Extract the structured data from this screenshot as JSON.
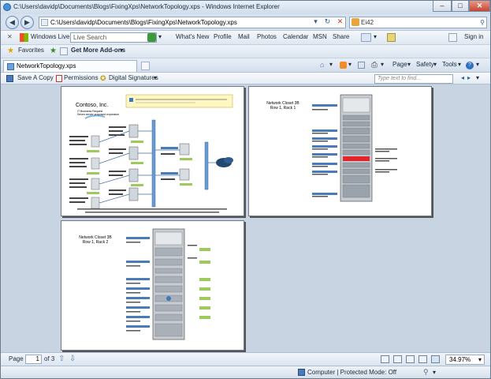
{
  "window": {
    "title": "C:\\Users\\davidp\\Documents\\Blogs\\FixingXps\\NetworkTopology.xps - Windows Internet Explorer",
    "minimize": "–",
    "maximize": "□",
    "close": "✕"
  },
  "address": {
    "url": "C:\\Users\\davidp\\Documents\\Blogs\\FixingXps\\NetworkTopology.xps",
    "search_value": "Ei42"
  },
  "toolbar": {
    "windows_live": "Windows Live",
    "live_search_placeholder": "Live Search",
    "links": [
      "What's New",
      "Profile",
      "Mail",
      "Photos",
      "Calendar",
      "MSN",
      "Share"
    ],
    "sign_in": "Sign in"
  },
  "favorites": {
    "favorites_label": "Favorites",
    "addons_label": "Get More Add-ons"
  },
  "tab": {
    "label": "NetworkTopology.xps"
  },
  "command_bar": {
    "page": "Page",
    "safety": "Safety",
    "tools": "Tools"
  },
  "xps_toolbar": {
    "save_copy": "Save A Copy",
    "permissions": "Permissions",
    "digital_signatures": "Digital Signatures",
    "find_placeholder": "Type text to find..."
  },
  "pages": {
    "page1": {
      "company": "Contoso, Inc.",
      "subtitle": "IT Business Request\nSeven server proposed expansion"
    },
    "page2": {
      "heading1": "Network Closet 3B",
      "heading2": "Row 1, Rack 1"
    },
    "page3": {
      "heading1": "Network Closet 3B",
      "heading2": "Row 1, Rack 2"
    }
  },
  "statusbar": {
    "page_label": "Page",
    "page_value": "1",
    "of_label": "of 3",
    "zoom": "34.97%",
    "zone": "Computer | Protected Mode: Off",
    "zone_zoom": ""
  }
}
